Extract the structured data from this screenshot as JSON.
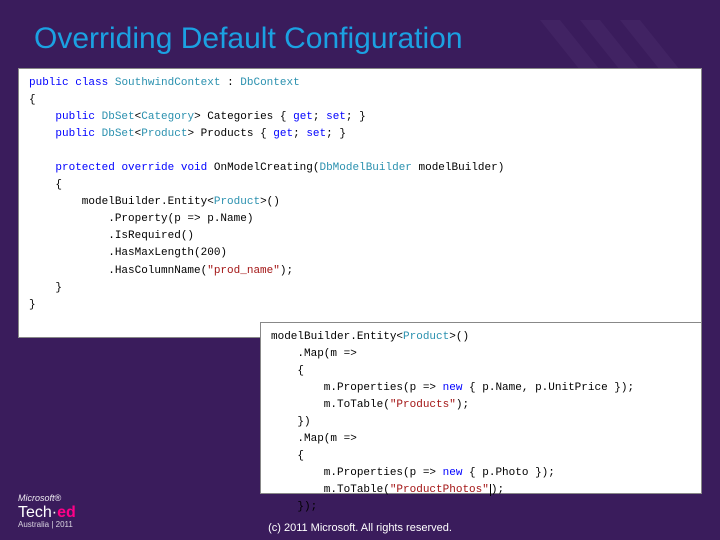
{
  "title": "Overriding Default Configuration",
  "code_upper": {
    "l01a": "public",
    "l01b": " ",
    "l01c": "class",
    "l01d": " ",
    "l01e": "SouthwindContext",
    "l01f": " : ",
    "l01g": "DbContext",
    "l02": "{",
    "l03a": "    ",
    "l03b": "public",
    "l03c": " ",
    "l03d": "DbSet",
    "l03e": "<",
    "l03f": "Category",
    "l03g": "> Categories { ",
    "l03h": "get",
    "l03i": "; ",
    "l03j": "set",
    "l03k": "; }",
    "l04a": "    ",
    "l04b": "public",
    "l04c": " ",
    "l04d": "DbSet",
    "l04e": "<",
    "l04f": "Product",
    "l04g": "> Products { ",
    "l04h": "get",
    "l04i": "; ",
    "l04j": "set",
    "l04k": "; }",
    "l05": "",
    "l06a": "    ",
    "l06b": "protected",
    "l06c": " ",
    "l06d": "override",
    "l06e": " ",
    "l06f": "void",
    "l06g": " OnModelCreating(",
    "l06h": "DbModelBuilder",
    "l06i": " modelBuilder)",
    "l07": "    {",
    "l08a": "        modelBuilder.Entity<",
    "l08b": "Product",
    "l08c": ">()",
    "l09": "            .Property(p => p.Name)",
    "l10": "            .IsRequired()",
    "l11": "            .HasMaxLength(200)",
    "l12a": "            .HasColumnName(",
    "l12b": "\"prod_name\"",
    "l12c": ");",
    "l13": "    }",
    "l14": "}"
  },
  "code_lower": {
    "l01a": "modelBuilder.Entity<",
    "l01b": "Product",
    "l01c": ">()",
    "l02": "    .Map(m =>",
    "l03": "    {",
    "l04a": "        m.Properties(p => ",
    "l04b": "new",
    "l04c": " { p.Name, p.UnitPrice });",
    "l05a": "        m.ToTable(",
    "l05b": "\"Products\"",
    "l05c": ");",
    "l06": "    })",
    "l07": "    .Map(m =>",
    "l08": "    {",
    "l09a": "        m.Properties(p => ",
    "l09b": "new",
    "l09c": " { p.Photo });",
    "l10a": "        m.ToTable(",
    "l10b": "\"ProductPhotos\"",
    "l10c": ");",
    "l11": "    });"
  },
  "footer": "(c) 2011 Microsoft. All rights reserved.",
  "logo": {
    "brand": "Microsoft®",
    "tech": "Tech·",
    "ed": "ed",
    "sub": "Australia | 2011"
  }
}
